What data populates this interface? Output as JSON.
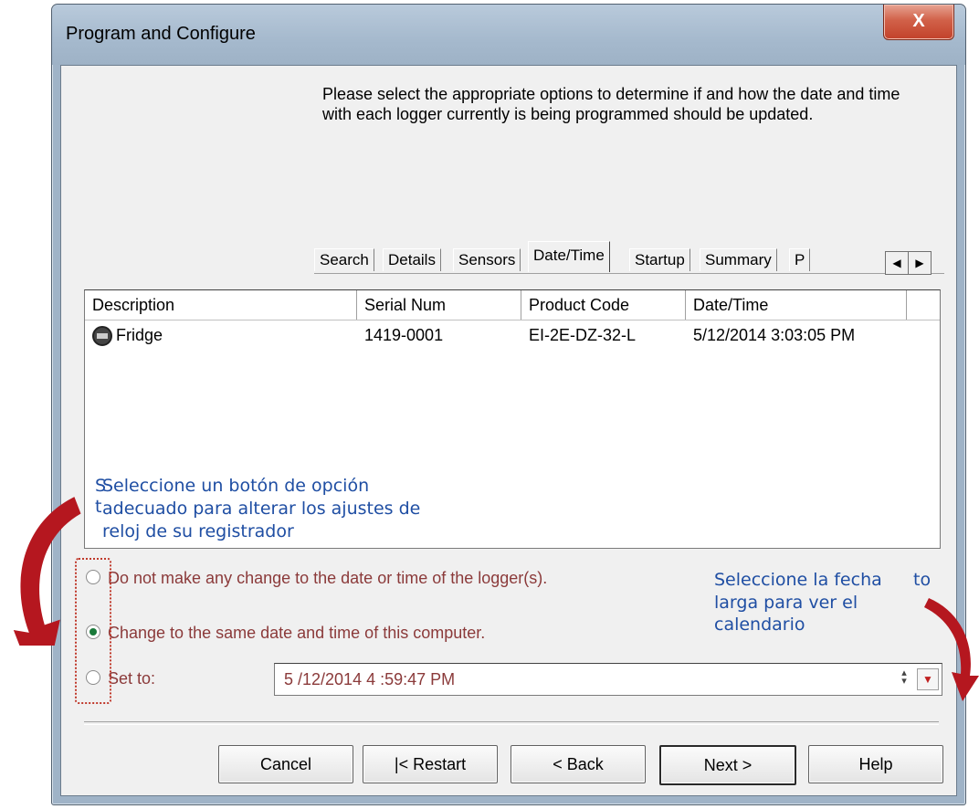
{
  "window": {
    "title": "Program and Configure",
    "close_glyph": "X"
  },
  "instructions": "Please select the appropriate options to determine if and how the date and time with each logger currently is being programmed should be updated.",
  "tabs": [
    "Search",
    "Details",
    "Sensors",
    "Date/Time",
    "Startup",
    "Summary",
    "P"
  ],
  "active_tab": "Date/Time",
  "tab_scroll": {
    "left_icon": "arrow-left-icon",
    "right_icon": "arrow-right-icon"
  },
  "list": {
    "columns": [
      "Description",
      "Serial Num",
      "Product Code",
      "Date/Time"
    ],
    "rows": [
      {
        "description": "Fridge",
        "serial": "1419-0001",
        "product_code": "EI-2E-DZ-32-L",
        "datetime": "5/12/2014 3:03:05 PM",
        "icon": "logger-icon"
      }
    ]
  },
  "annotations": {
    "left_stray": "S",
    "left_stray2": "t",
    "left_line1": "Seleccione un botón de opción",
    "left_line2": "adecuado para alterar los ajustes de",
    "left_line3": "reloj de su registrador",
    "right_line1": "Seleccione la fecha",
    "right_frag": "to",
    "right_line2": "larga para ver el",
    "right_line3": "calendario",
    "arrow_color": "#b5171f"
  },
  "options": {
    "no_change": "Do not make any change to the date or time of the logger(s).",
    "same_as_computer": "Change to the same date and time of this computer.",
    "set_to": "Set to:",
    "selected": "same_as_computer"
  },
  "date_field": {
    "value": "5 /12/2014   4 :59:47 PM"
  },
  "buttons": {
    "cancel": "Cancel",
    "restart": "|< Restart",
    "back": "< Back",
    "next": "Next >",
    "help": "Help"
  },
  "colors": {
    "option_text": "#8b3a3a",
    "annotation_text": "#1f4ea3",
    "titlebar": "#a5b9cd",
    "close_button": "#c9503a"
  }
}
